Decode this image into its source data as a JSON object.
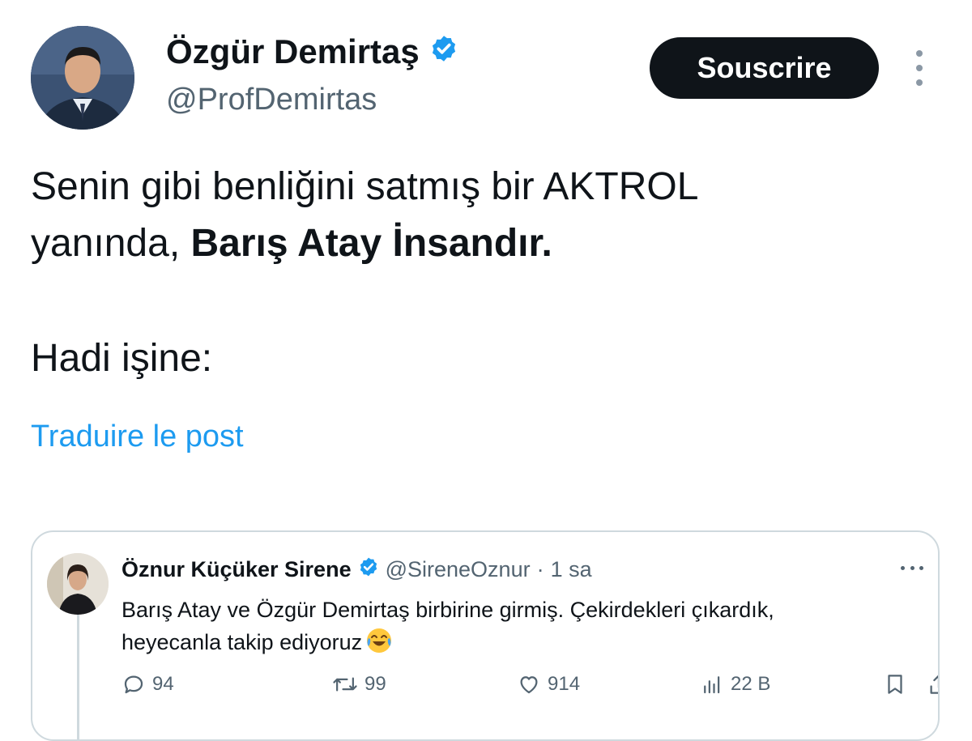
{
  "tweet": {
    "author": {
      "name": "Özgür Demirtaş",
      "handle": "@ProfDemirtas",
      "verified": true,
      "verified_color": "#1d9bf0"
    },
    "subscribe_label": "Souscrire",
    "more_icon": "more-vertical-icon",
    "text": {
      "line1_part1": "Senin gibi benliğini satmış bir AKTROL",
      "line2_part1": "yanında, ",
      "line2_bold": "Barış Atay İnsandır.",
      "line3": "Hadi işine:"
    },
    "translate_label": "Traduire le post"
  },
  "quoted": {
    "author_name": "Öznur Küçüker Sirene",
    "verified": true,
    "handle": "@SireneOznur",
    "separator": "·",
    "time": "1 sa",
    "text_line1": "Barış Atay ve Özgür Demirtaş birbirine girmiş. Çekirdekleri çıkardık,",
    "text_line2": "heyecanla takip ediyoruz",
    "emoji": "face-with-tears-of-joy-icon",
    "actions": {
      "replies": "94",
      "retweets": "99",
      "likes": "914",
      "views": "22 B"
    }
  },
  "colors": {
    "text": "#0f1419",
    "secondary": "#536471",
    "link": "#1d9bf0",
    "border": "#cfd9de",
    "button_bg": "#0f1419"
  }
}
